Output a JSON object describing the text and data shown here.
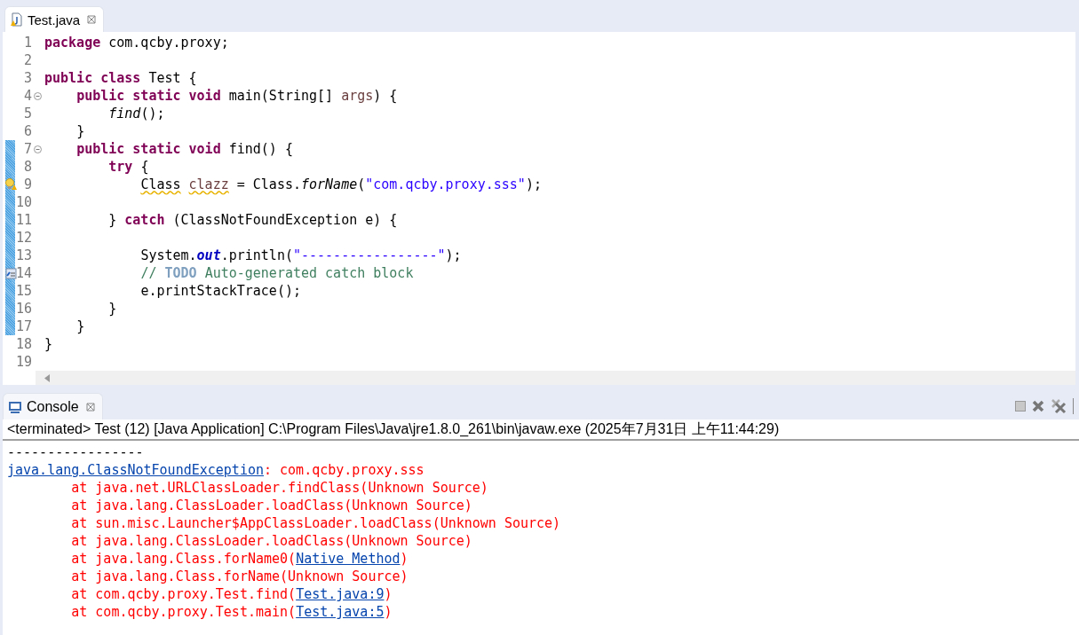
{
  "editor": {
    "tab": {
      "title": "Test.java",
      "selected": true
    },
    "lines": [
      {
        "number": "1",
        "fold": false,
        "changed": false,
        "warning": false,
        "task": false,
        "tokens": [
          {
            "text": "package",
            "kind": "keyword"
          },
          {
            "text": " com.qcby.proxy;",
            "kind": "plain"
          }
        ]
      },
      {
        "number": "2",
        "fold": false,
        "changed": false,
        "warning": false,
        "task": false
      },
      {
        "number": "3",
        "fold": false,
        "changed": false,
        "warning": false,
        "task": false,
        "tokens": [
          {
            "text": "public class",
            "kind": "keyword"
          },
          {
            "text": " Test {",
            "kind": "plain"
          }
        ]
      },
      {
        "number": "4",
        "fold": true,
        "changed": false,
        "warning": false,
        "task": false,
        "tokens": [
          {
            "text": "    public static void",
            "kind": "keyword"
          },
          {
            "text": " main(String[] ",
            "kind": "plain"
          },
          {
            "text": "args",
            "kind": "param"
          },
          {
            "text": ") {",
            "kind": "plain"
          }
        ]
      },
      {
        "number": "5",
        "fold": false,
        "changed": false,
        "warning": false,
        "task": false,
        "tokens": [
          {
            "text": "        find",
            "kind": "static"
          },
          {
            "text": "();",
            "kind": "plain"
          }
        ]
      },
      {
        "number": "6",
        "fold": false,
        "changed": false,
        "warning": false,
        "task": false,
        "tokens": [
          {
            "text": "    }",
            "kind": "plain"
          }
        ]
      },
      {
        "number": "7",
        "fold": true,
        "changed": true,
        "warning": false,
        "task": false,
        "tokens": [
          {
            "text": "    public static void",
            "kind": "keyword"
          },
          {
            "text": " find() {",
            "kind": "plain"
          }
        ]
      },
      {
        "number": "8",
        "fold": false,
        "changed": true,
        "warning": false,
        "task": false,
        "tokens": [
          {
            "text": "        try",
            "kind": "keyword"
          },
          {
            "text": " {",
            "kind": "plain"
          }
        ]
      },
      {
        "number": "9",
        "fold": false,
        "changed": true,
        "warning": true,
        "task": false,
        "tokens": [
          {
            "text": "            Class",
            "kind": "warned"
          },
          {
            "text": " clazz",
            "kind": "warned-local"
          },
          {
            "text": " = Class.",
            "kind": "plain"
          },
          {
            "text": "forName",
            "kind": "static"
          },
          {
            "text": "(",
            "kind": "plain"
          },
          {
            "text": "\"com.qcby.proxy.sss\"",
            "kind": "string"
          },
          {
            "text": ");",
            "kind": "plain"
          }
        ]
      },
      {
        "number": "10",
        "fold": false,
        "changed": true,
        "warning": false,
        "task": false
      },
      {
        "number": "11",
        "fold": false,
        "changed": true,
        "warning": false,
        "task": false,
        "tokens": [
          {
            "text": "        } ",
            "kind": "plain"
          },
          {
            "text": "catch",
            "kind": "keyword"
          },
          {
            "text": " (ClassNotFoundException e) {",
            "kind": "plain"
          }
        ]
      },
      {
        "number": "12",
        "fold": false,
        "changed": true,
        "warning": false,
        "task": false
      },
      {
        "number": "13",
        "fold": false,
        "changed": true,
        "warning": false,
        "task": false,
        "tokens": [
          {
            "text": "            System.",
            "kind": "plain"
          },
          {
            "text": "out",
            "kind": "field"
          },
          {
            "text": ".println(",
            "kind": "plain"
          },
          {
            "text": "\"-----------------\"",
            "kind": "string"
          },
          {
            "text": ");",
            "kind": "plain"
          }
        ]
      },
      {
        "number": "14",
        "fold": false,
        "changed": true,
        "warning": false,
        "task": true,
        "tokens": [
          {
            "text": "            // ",
            "kind": "comment"
          },
          {
            "text": "TODO",
            "kind": "todo"
          },
          {
            "text": " Auto-generated catch block",
            "kind": "comment"
          }
        ]
      },
      {
        "number": "15",
        "fold": false,
        "changed": true,
        "warning": false,
        "task": false,
        "tokens": [
          {
            "text": "            e.printStackTrace();",
            "kind": "plain"
          }
        ]
      },
      {
        "number": "16",
        "fold": false,
        "changed": true,
        "warning": false,
        "task": false,
        "tokens": [
          {
            "text": "        }",
            "kind": "plain"
          }
        ]
      },
      {
        "number": "17",
        "fold": false,
        "changed": true,
        "warning": false,
        "task": false,
        "tokens": [
          {
            "text": "    }",
            "kind": "plain"
          }
        ]
      },
      {
        "number": "18",
        "fold": false,
        "changed": false,
        "warning": false,
        "task": false,
        "tokens": [
          {
            "text": "}",
            "kind": "plain"
          }
        ]
      },
      {
        "number": "19",
        "fold": false,
        "changed": false,
        "warning": false,
        "task": false
      }
    ]
  },
  "console": {
    "tab": {
      "title": "Console",
      "selected": true
    },
    "header": "<terminated> Test (12) [Java Application] C:\\Program Files\\Java\\jre1.8.0_261\\bin\\javaw.exe (2025年7月31日 上午11:44:29)",
    "lines": [
      {
        "segments": [
          {
            "text": "-----------------",
            "kind": "out"
          }
        ]
      },
      {
        "segments": [
          {
            "text": "java.lang.ClassNotFoundException",
            "kind": "link"
          },
          {
            "text": ": com.qcby.proxy.sss",
            "kind": "err"
          }
        ]
      },
      {
        "segments": [
          {
            "text": "\tat java.net.URLClassLoader.findClass(Unknown Source)",
            "kind": "err"
          }
        ]
      },
      {
        "segments": [
          {
            "text": "\tat java.lang.ClassLoader.loadClass(Unknown Source)",
            "kind": "err"
          }
        ]
      },
      {
        "segments": [
          {
            "text": "\tat sun.misc.Launcher$AppClassLoader.loadClass(Unknown Source)",
            "kind": "err"
          }
        ]
      },
      {
        "segments": [
          {
            "text": "\tat java.lang.ClassLoader.loadClass(Unknown Source)",
            "kind": "err"
          }
        ]
      },
      {
        "segments": [
          {
            "text": "\tat java.lang.Class.forName0(",
            "kind": "err"
          },
          {
            "text": "Native Method",
            "kind": "link"
          },
          {
            "text": ")",
            "kind": "err"
          }
        ]
      },
      {
        "segments": [
          {
            "text": "\tat java.lang.Class.forName(Unknown Source)",
            "kind": "err"
          }
        ]
      },
      {
        "segments": [
          {
            "text": "\tat com.qcby.proxy.Test.find(",
            "kind": "err"
          },
          {
            "text": "Test.java:9",
            "kind": "link"
          },
          {
            "text": ")",
            "kind": "err"
          }
        ]
      },
      {
        "segments": [
          {
            "text": "\tat com.qcby.proxy.Test.main(",
            "kind": "err"
          },
          {
            "text": "Test.java:5",
            "kind": "link"
          },
          {
            "text": ")",
            "kind": "err"
          }
        ]
      }
    ]
  }
}
